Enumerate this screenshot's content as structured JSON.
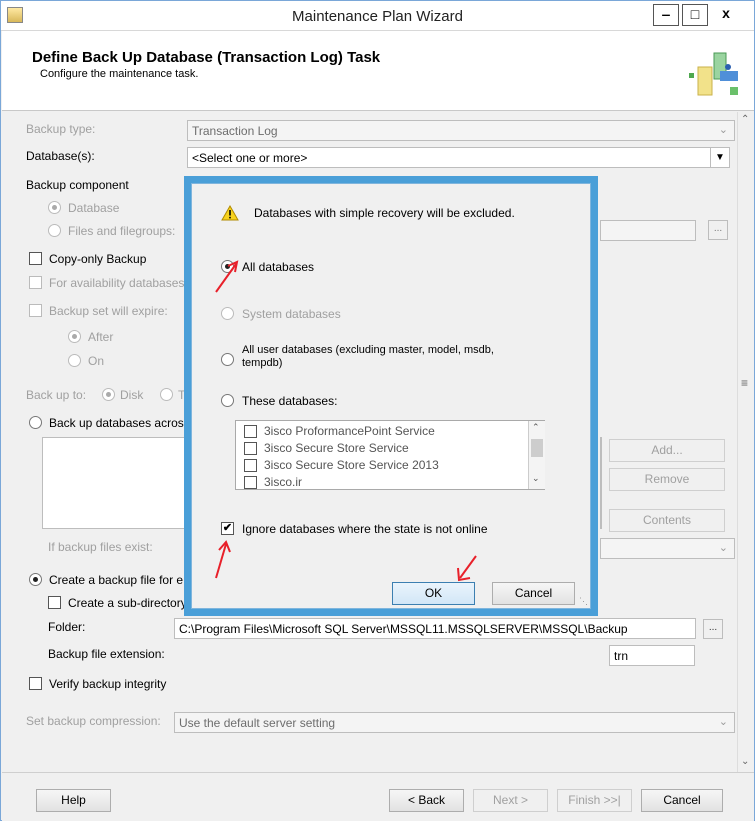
{
  "window": {
    "title": "Maintenance Plan Wizard",
    "controls": [
      "‒",
      "□",
      "x"
    ]
  },
  "header": {
    "title": "Define Back Up Database (Transaction Log) Task",
    "subtitle": "Configure the maintenance task."
  },
  "form": {
    "backup_type_label": "Backup type:",
    "backup_type_value": "Transaction Log",
    "databases_label": "Database(s):",
    "databases_value": "<Select one or more>",
    "backup_component_label": "Backup component",
    "opt_database": "Database",
    "opt_files": "Files and filegroups:",
    "copy_only_label": "Copy-only Backup",
    "availability_label": "For availability databases,",
    "expire_label": "Backup set will expire:",
    "opt_after": "After",
    "opt_on": "On",
    "backup_to_label": "Back up to:",
    "opt_disk": "Disk",
    "opt_tape": "T",
    "across_label": "Back up databases acros",
    "add_button": "Add...",
    "remove_button": "Remove",
    "contents_button": "Contents",
    "if_exist_label": "If backup files exist:",
    "create_file_label": "Create a backup file for e",
    "subdir_label": "Create a sub-directory",
    "folder_label": "Folder:",
    "folder_value": "C:\\Program Files\\Microsoft SQL Server\\MSSQL11.MSSQLSERVER\\MSSQL\\Backup",
    "browse_button": "...",
    "extension_label": "Backup file extension:",
    "extension_value": "trn",
    "verify_label": "Verify backup integrity",
    "compression_label": "Set backup compression:",
    "compression_value": "Use the default server setting"
  },
  "dialog": {
    "warning_text": "Databases with simple recovery will be excluded.",
    "opt_all": "All databases",
    "opt_system": "System databases",
    "opt_user_line1": "All user databases  (excluding master, model, msdb,",
    "opt_user_line2": "tempdb)",
    "opt_these": "These databases:",
    "db_list": [
      "3isco ProformancePoint Service",
      "3isco Secure Store Service",
      "3isco Secure Store Service 2013",
      "3isco.ir"
    ],
    "ignore_label": "Ignore databases where the state is not online",
    "ignore_checked": true,
    "ok_button": "OK",
    "cancel_button": "Cancel"
  },
  "footer": {
    "help": "Help",
    "back": "< Back",
    "next": "Next >",
    "finish": "Finish >>|",
    "cancel": "Cancel"
  },
  "colors": {
    "dialog_border": "#4a9fd8",
    "annotation_arrow": "#e8202a"
  }
}
